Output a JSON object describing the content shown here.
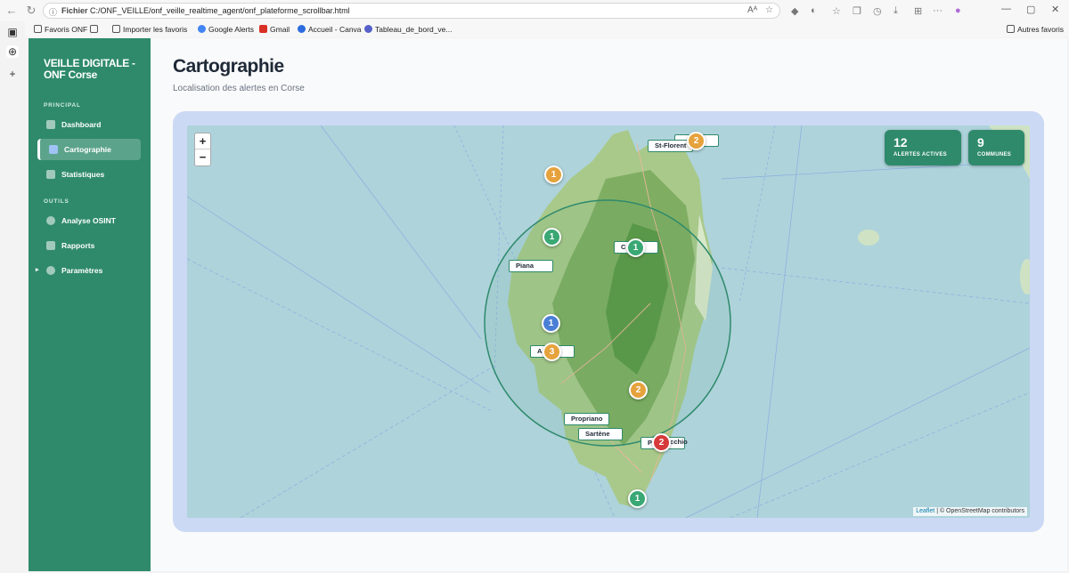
{
  "browser": {
    "scheme_label": "Fichier",
    "url": "C:/ONF_VEILLE/onf_veille_realtime_agent/onf_plateforme_scrollbar.html",
    "bookmarks": [
      "Favoris ONF",
      "Importer les favoris",
      "Google Alerts",
      "Gmail",
      "Accueil - Canva",
      "Tableau_de_bord_ve...",
      "Autres favoris"
    ]
  },
  "sidebar": {
    "brand": "VEILLE DIGITALE - ONF Corse",
    "section_principal": "PRINCIPAL",
    "section_outils": "OUTILS",
    "items": [
      {
        "label": "Dashboard",
        "icon": "chart-icon",
        "active": false
      },
      {
        "label": "Cartographie",
        "icon": "map-icon",
        "active": true
      },
      {
        "label": "Statistiques",
        "icon": "stats-icon",
        "active": false
      },
      {
        "label": "Analyse OSINT",
        "icon": "globe-icon",
        "active": false
      },
      {
        "label": "Rapports",
        "icon": "document-icon",
        "active": false
      },
      {
        "label": "Paramètres",
        "icon": "gear-icon",
        "active": false
      }
    ]
  },
  "header": {
    "title": "Cartographie",
    "subtitle": "Localisation des alertes en Corse"
  },
  "map": {
    "zoom_in": "+",
    "zoom_out": "−",
    "stats": [
      {
        "value": "12",
        "label": "ALERTES ACTIVES"
      },
      {
        "value": "9",
        "label": "COMMUNES"
      }
    ],
    "place_labels": [
      "St-Florent",
      "C",
      "Piana",
      "A",
      "Propriano",
      "Sartène",
      "P",
      "ecchio"
    ],
    "markers": [
      {
        "count": "2",
        "color": "#e6a23c"
      },
      {
        "count": "1",
        "color": "#e6a23c"
      },
      {
        "count": "1",
        "color": "#3aa874"
      },
      {
        "count": "1",
        "color": "#3aa874"
      },
      {
        "count": "1",
        "color": "#4a7fd6"
      },
      {
        "count": "3",
        "color": "#e6a23c"
      },
      {
        "count": "2",
        "color": "#e6a23c"
      },
      {
        "count": "2",
        "color": "#d63a3a"
      },
      {
        "count": "1",
        "color": "#3aa874"
      }
    ],
    "attribution_link": "Leaflet",
    "attribution_text": "| © OpenStreetMap contributors"
  }
}
